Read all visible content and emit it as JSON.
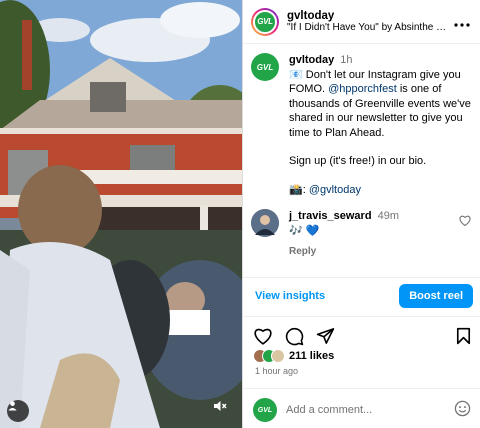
{
  "post": {
    "username": "gvltoday",
    "audio": "\"If I Didn't Have You\" by Absinthe Min...",
    "avatar_text": "GVL"
  },
  "caption": {
    "username": "gvltoday",
    "time": "1h",
    "line1_prefix": "📧 Don't let our Instagram give you FOMO. ",
    "mention": "@hpporchfest",
    "line1_suffix": " is one of thousands of Greenville events we've shared in our newsletter to give you time to Plan Ahead.",
    "line2": "Sign up (it's free!) in our bio.",
    "credit_prefix": "📸: ",
    "credit_handle": "@gvltoday"
  },
  "comment": {
    "username": "j_travis_seward",
    "time": "49m",
    "text": "🎶 💙",
    "reply_label": "Reply"
  },
  "actions": {
    "view_insights": "View insights",
    "boost": "Boost reel"
  },
  "likes": {
    "count": "211 likes",
    "time_ago": "1 hour ago"
  },
  "composer": {
    "placeholder": "Add a comment..."
  },
  "colors": {
    "accent": "#0095f6",
    "brand": "#22a449",
    "muted": "#737373"
  },
  "icons": [
    "user-tag-icon",
    "mute-icon",
    "more-icon",
    "heart-icon",
    "comment-icon",
    "share-icon",
    "bookmark-icon",
    "emoji-icon"
  ]
}
